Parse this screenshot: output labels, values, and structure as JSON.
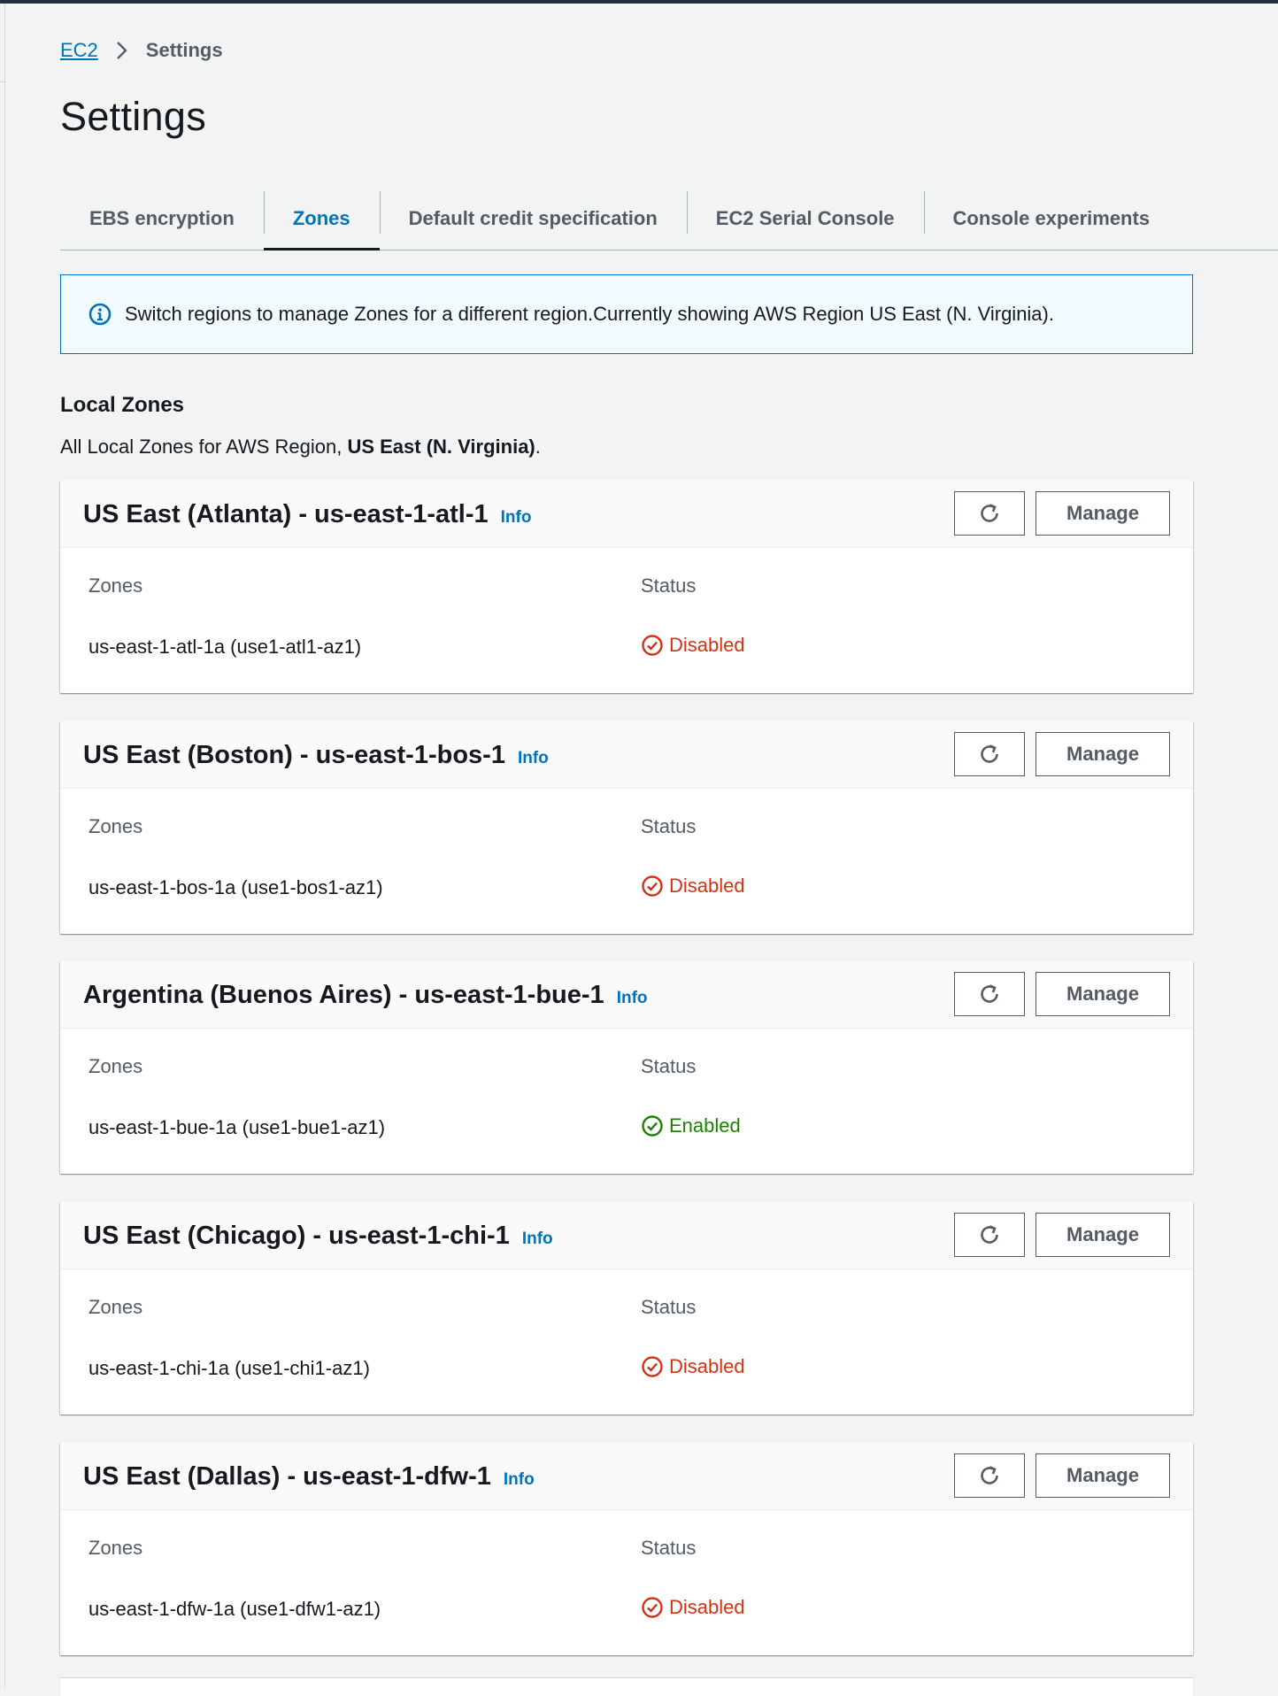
{
  "breadcrumb": {
    "root": "EC2",
    "current": "Settings"
  },
  "page_title": "Settings",
  "tabs": [
    {
      "label": "EBS encryption",
      "active": false
    },
    {
      "label": "Zones",
      "active": true
    },
    {
      "label": "Default credit specification",
      "active": false
    },
    {
      "label": "EC2 Serial Console",
      "active": false
    },
    {
      "label": "Console experiments",
      "active": false
    }
  ],
  "info_banner": {
    "text": "Switch regions to manage Zones for a different region.Currently showing AWS Region US East (N. Virginia)."
  },
  "local_zones": {
    "title": "Local Zones",
    "desc_prefix": "All Local Zones for AWS Region, ",
    "desc_region": "US East (N. Virginia)",
    "desc_suffix": "."
  },
  "labels": {
    "info": "Info",
    "manage": "Manage",
    "zones_col": "Zones",
    "status_col": "Status"
  },
  "groups": [
    {
      "title": "US East (Atlanta) - us-east-1-atl-1",
      "zone": "us-east-1-atl-1a (use1-atl1-az1)",
      "status": "Disabled"
    },
    {
      "title": "US East (Boston) - us-east-1-bos-1",
      "zone": "us-east-1-bos-1a (use1-bos1-az1)",
      "status": "Disabled"
    },
    {
      "title": "Argentina (Buenos Aires) - us-east-1-bue-1",
      "zone": "us-east-1-bue-1a (use1-bue1-az1)",
      "status": "Enabled"
    },
    {
      "title": "US East (Chicago) - us-east-1-chi-1",
      "zone": "us-east-1-chi-1a (use1-chi1-az1)",
      "status": "Disabled"
    },
    {
      "title": "US East (Dallas) - us-east-1-dfw-1",
      "zone": "us-east-1-dfw-1a (use1-dfw1-az1)",
      "status": "Disabled"
    }
  ],
  "colors": {
    "link": "#0073bb",
    "disabled": "#d13212",
    "enabled": "#1d8102",
    "topbar": "#232f3e"
  }
}
